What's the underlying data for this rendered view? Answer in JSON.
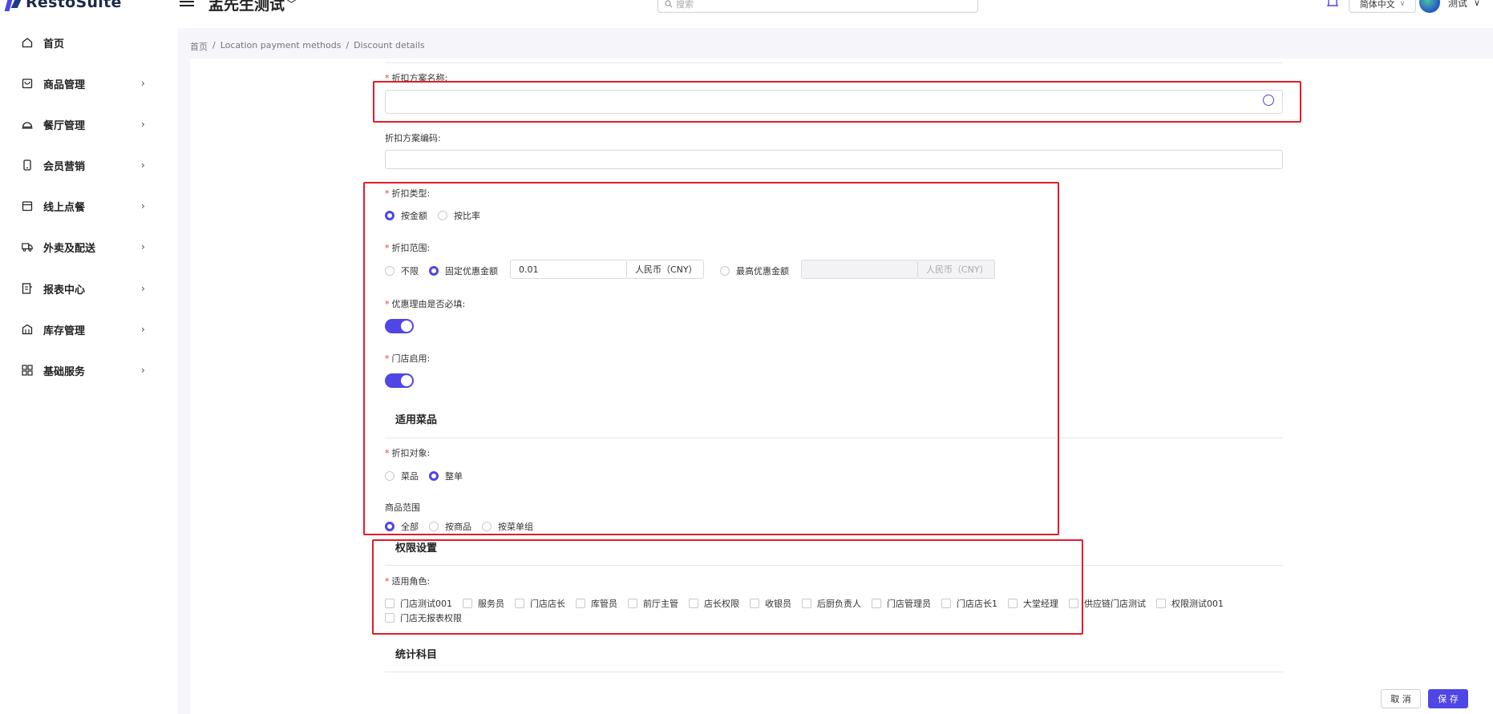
{
  "app": {
    "logo_text": "RestoSuite",
    "store_name": "孟先生测试",
    "search_placeholder": "搜索",
    "language": "简体中文",
    "user_name": "测试"
  },
  "sidebar": {
    "items": [
      {
        "label": "首页",
        "icon": "home-icon",
        "has_submenu": false
      },
      {
        "label": "商品管理",
        "icon": "bag-icon",
        "has_submenu": true
      },
      {
        "label": "餐厅管理",
        "icon": "cloche-icon",
        "has_submenu": true
      },
      {
        "label": "会员营销",
        "icon": "phone-icon",
        "has_submenu": true
      },
      {
        "label": "线上点餐",
        "icon": "calendar-icon",
        "has_submenu": true
      },
      {
        "label": "外卖及配送",
        "icon": "truck-icon",
        "has_submenu": true
      },
      {
        "label": "报表中心",
        "icon": "report-icon",
        "has_submenu": true
      },
      {
        "label": "库存管理",
        "icon": "warehouse-icon",
        "has_submenu": true
      },
      {
        "label": "基础服务",
        "icon": "grid-icon",
        "has_submenu": true
      }
    ]
  },
  "breadcrumb": [
    "首页",
    "Location payment methods",
    "Discount details"
  ],
  "breadcrumb_sep": "/",
  "form": {
    "scheme_name": {
      "label": "折扣方案名称:",
      "required": true,
      "value": ""
    },
    "scheme_code": {
      "label": "折扣方案编码:",
      "required": false,
      "value": ""
    },
    "discount_type": {
      "label": "折扣类型:",
      "required": true,
      "options": [
        "按金额",
        "按比率"
      ],
      "selected": "按金额"
    },
    "discount_range": {
      "label": "折扣范围:",
      "required": true,
      "opt_unlimited": "不限",
      "opt_fixed": "固定优惠金额",
      "fixed_value": "0.01",
      "fixed_unit": "人民币（CNY）",
      "opt_max": "最高优惠金额",
      "max_value": "",
      "max_unit": "人民币（CNY）",
      "selected": "固定优惠金额"
    },
    "reason_required": {
      "label": "优惠理由是否必填:",
      "required": true,
      "on": true
    },
    "store_enabled": {
      "label": "门店启用:",
      "required": true,
      "on": true
    },
    "applicable_dishes_title": "适用菜品",
    "discount_target": {
      "label": "折扣对象:",
      "required": true,
      "options": [
        "菜品",
        "整单"
      ],
      "selected": "整单"
    },
    "product_scope": {
      "label": "商品范围",
      "required": false,
      "options": [
        "全部",
        "按商品",
        "按菜单组"
      ],
      "selected": "全部"
    },
    "permission_title": "权限设置",
    "roles": {
      "label": "适用角色:",
      "required": true,
      "row1": [
        "门店测试001",
        "服务员",
        "门店店长",
        "库管员",
        "前厅主管",
        "店长权限",
        "收银员",
        "后厨负责人",
        "门店管理员",
        "门店店长1",
        "大堂经理",
        "供应链门店测试",
        "权限测试001"
      ],
      "row2": [
        "门店无报表权限"
      ]
    },
    "stats_title": "统计科目"
  },
  "footer": {
    "cancel": "取 消",
    "save": "保 存"
  },
  "colors": {
    "accent": "#4f46e5",
    "highlight": "#e11d2a",
    "required": "#e53935"
  }
}
